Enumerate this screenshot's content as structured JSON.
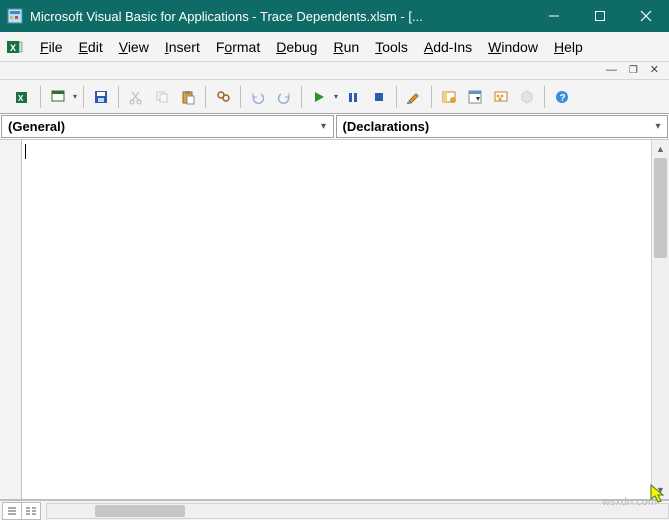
{
  "title": "Microsoft Visual Basic for Applications - Trace Dependents.xlsm - [...",
  "menu": {
    "file": {
      "pre": "",
      "u": "F",
      "post": "ile"
    },
    "edit": {
      "pre": "",
      "u": "E",
      "post": "dit"
    },
    "view": {
      "pre": "",
      "u": "V",
      "post": "iew"
    },
    "insert": {
      "pre": "",
      "u": "I",
      "post": "nsert"
    },
    "format": {
      "pre": "F",
      "u": "o",
      "post": "rmat"
    },
    "debug": {
      "pre": "",
      "u": "D",
      "post": "ebug"
    },
    "run": {
      "pre": "",
      "u": "R",
      "post": "un"
    },
    "tools": {
      "pre": "",
      "u": "T",
      "post": "ools"
    },
    "addins": {
      "pre": "",
      "u": "A",
      "post": "dd-Ins"
    },
    "window": {
      "pre": "",
      "u": "W",
      "post": "indow"
    },
    "help": {
      "pre": "",
      "u": "H",
      "post": "elp"
    }
  },
  "dropdowns": {
    "object": "(General)",
    "procedure": "(Declarations)"
  },
  "watermark": "wsxdn.com"
}
